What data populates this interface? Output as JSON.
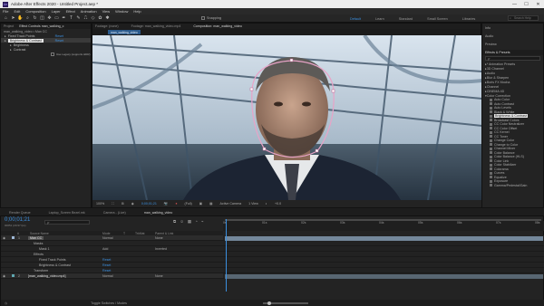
{
  "app": {
    "title": "Adobe After Effects 2020 - Untitled Project.aep *",
    "window_controls": [
      "—",
      "☐",
      "✕"
    ]
  },
  "menu": [
    "File",
    "Edit",
    "Composition",
    "Layer",
    "Effect",
    "Animation",
    "View",
    "Window",
    "Help"
  ],
  "toolbar": {
    "snapping_label": "Snapping",
    "workspaces": [
      {
        "label": "Default",
        "active": true
      },
      {
        "label": "Learn",
        "active": false
      },
      {
        "label": "Standard",
        "active": false
      },
      {
        "label": "Small Screen",
        "active": false
      },
      {
        "label": "Libraries",
        "active": false
      }
    ],
    "search_placeholder": "Search Help"
  },
  "left_panel": {
    "tabs": [
      "Project",
      "Effect Controls man_walking_c"
    ],
    "breadcrumb": "man_walking_video • Man CC",
    "effects": [
      {
        "name": "Fixed Track Points",
        "value": "Reset"
      },
      {
        "name": "Brightness & Contrast",
        "value": "Reset"
      },
      {
        "name": "Brightness",
        "value": ""
      },
      {
        "name": "Contrast",
        "value": ""
      }
    ],
    "legacy_label": "Use Legacy (supports HDR)"
  },
  "viewer": {
    "tabs": [
      "Footage: (none)",
      "Footage: man_walking_video.mp4",
      "Composition: man_walking_video"
    ],
    "active_tab": "man_walking_video",
    "zoom": "100%",
    "timecode": "0;00;01;21",
    "resolution": "(Full)",
    "camera": "Active Camera",
    "views": "1 View",
    "offset": "+0.0"
  },
  "right_panel": {
    "items_top": [
      "Info",
      "Audio",
      "Preview"
    ],
    "title": "Effects & Presets",
    "search_placeholder": "ρ·",
    "categories": [
      "* Animation Presets",
      "3D Channel",
      "Audio",
      "Blur & Sharpen",
      "Boris FX Mocha",
      "Channel",
      "CINEMA 4D",
      "Color Correction"
    ],
    "color_correction": [
      "Auto Color",
      "Auto Contrast",
      "Auto Levels",
      "Black & White",
      "Brightness & Contrast",
      "Broadcast Colors",
      "CC Color Neutralizer",
      "CC Color Offset",
      "CC Kernel",
      "CC Toner",
      "Change Color",
      "Change to Color",
      "Channel Mixer",
      "Color Balance",
      "Color Balance (HLS)",
      "Color Link",
      "Color Stabilizer",
      "Colorama",
      "Curves",
      "Equalize",
      "Exposure",
      "Gamma/Pedestal/Gain"
    ],
    "selected": "Brightness & Contrast"
  },
  "bottom_tabs": [
    "Render Queue",
    "Laptop_Screen Bezel.mk",
    "Camera - (Live)",
    "man_walking_video"
  ],
  "timeline": {
    "timecode": "0;00;01;21",
    "fps": "00051 (29.97 fps)",
    "search_placeholder": "ρ·",
    "columns": [
      "#",
      "Source Name",
      "Mode",
      "T",
      "TrkMat",
      "Parent & Link"
    ],
    "layers": [
      {
        "num": "1",
        "name": "Man CC",
        "mode": "Normal",
        "parent": "None",
        "level": 0,
        "color": "#9fb8d6"
      },
      {
        "num": "",
        "name": "Masks",
        "mode": "",
        "parent": "",
        "level": 1,
        "color": ""
      },
      {
        "num": "",
        "name": "Mask 1",
        "mode": "Add",
        "parent": "Inverted",
        "level": 2,
        "color": ""
      },
      {
        "num": "",
        "name": "Effects",
        "mode": "",
        "parent": "",
        "level": 1,
        "color": ""
      },
      {
        "num": "",
        "name": "Fixed Track Points",
        "mode": "Reset",
        "parent": "",
        "level": 2,
        "color": ""
      },
      {
        "num": "",
        "name": "Brightness & Contrast",
        "mode": "Reset",
        "parent": "",
        "level": 2,
        "color": ""
      },
      {
        "num": "",
        "name": "Transform",
        "mode": "Reset",
        "parent": "",
        "level": 1,
        "color": ""
      },
      {
        "num": "2",
        "name": "[man_walking_video.mp4]",
        "mode": "Normal",
        "parent": "None",
        "level": 0,
        "color": "#5fa7b0"
      }
    ],
    "ruler": [
      "0s",
      "01s",
      "02s",
      "03s",
      "04s",
      "05s",
      "06s",
      "07s",
      "08s"
    ],
    "toggle_label": "Toggle Switches / Modes"
  },
  "colors": {
    "accent": "#3b8fdf",
    "playhead": "#3b8fdf",
    "layer_bar": "#7d94a8"
  }
}
